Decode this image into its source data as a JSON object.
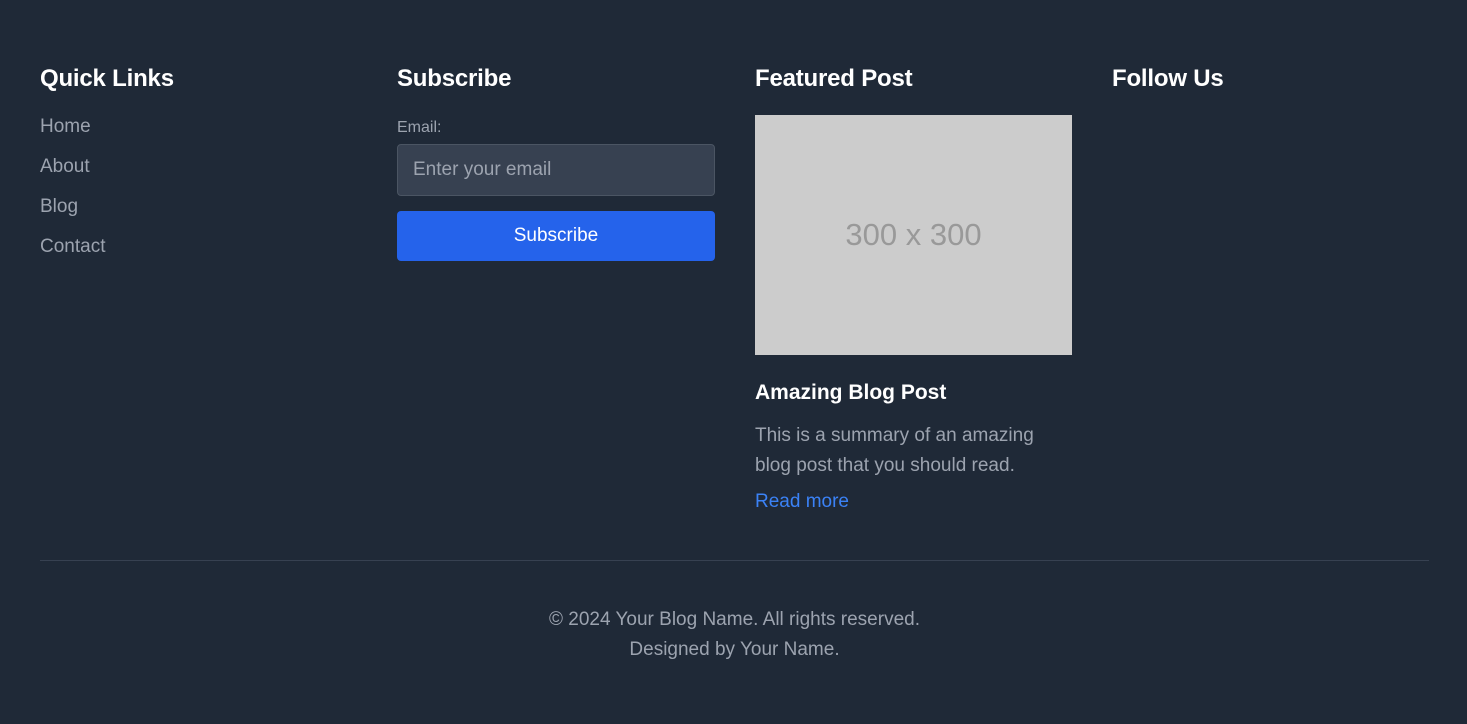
{
  "quick_links": {
    "title": "Quick Links",
    "items": [
      {
        "label": "Home"
      },
      {
        "label": "About"
      },
      {
        "label": "Blog"
      },
      {
        "label": "Contact"
      }
    ]
  },
  "subscribe": {
    "title": "Subscribe",
    "email_label": "Email:",
    "email_placeholder": "Enter your email",
    "email_value": "",
    "button_label": "Subscribe"
  },
  "featured_post": {
    "title": "Featured Post",
    "image_placeholder_text": "300 x 300",
    "post_title": "Amazing Blog Post",
    "summary": "This is a summary of an amazing blog post that you should read.",
    "read_more_label": "Read more"
  },
  "follow_us": {
    "title": "Follow Us"
  },
  "bottom": {
    "copyright": "© 2024 Your Blog Name. All rights reserved.",
    "designed_by": "Designed by Your Name."
  },
  "colors": {
    "background": "#1f2937",
    "accent": "#2563eb",
    "link": "#3b82f6",
    "muted_text": "#9ca3af",
    "input_bg": "#374151"
  }
}
